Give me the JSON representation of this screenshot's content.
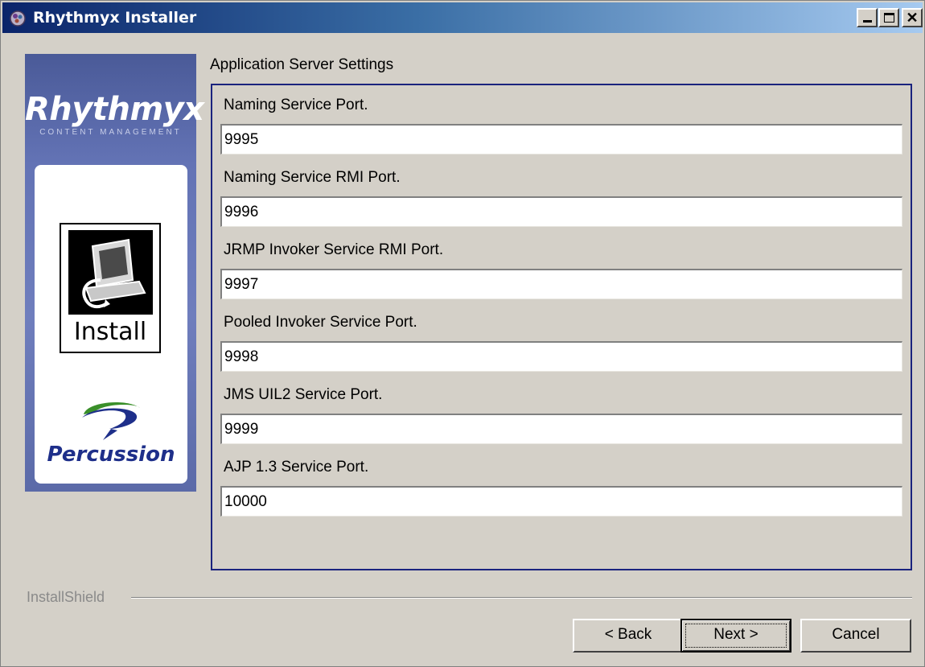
{
  "window": {
    "title": "Rhythmyx Installer",
    "controls": [
      "minimize",
      "maximize",
      "close"
    ]
  },
  "side_panel": {
    "brand": "Rhythmyx",
    "brand_sub": "CONTENT MANAGEMENT",
    "install_label": "Install",
    "vendor": "Percussion"
  },
  "main": {
    "section_title": "Application Server Settings",
    "fields": [
      {
        "label": "Naming Service Port.",
        "value": "9995"
      },
      {
        "label": "Naming Service RMI Port.",
        "value": "9996"
      },
      {
        "label": "JRMP Invoker Service RMI Port.",
        "value": "9997"
      },
      {
        "label": "Pooled Invoker Service Port.",
        "value": "9998"
      },
      {
        "label": "JMS UIL2 Service Port.",
        "value": "9999"
      },
      {
        "label": "AJP 1.3 Service Port.",
        "value": "10000"
      }
    ]
  },
  "footer": {
    "installshield": "InstallShield",
    "back_label": "< Back",
    "next_label": "Next >",
    "cancel_label": "Cancel"
  },
  "colors": {
    "titlebar_start": "#0a246a",
    "titlebar_end": "#a6caf0",
    "panel": "#6373b5",
    "content_border": "#1a237e",
    "vendor_green": "#3a8f2a",
    "vendor_blue": "#1e2f8a"
  },
  "icons": [
    "installer-app-icon",
    "install-computer-icon",
    "percussion-swoosh-logo"
  ]
}
